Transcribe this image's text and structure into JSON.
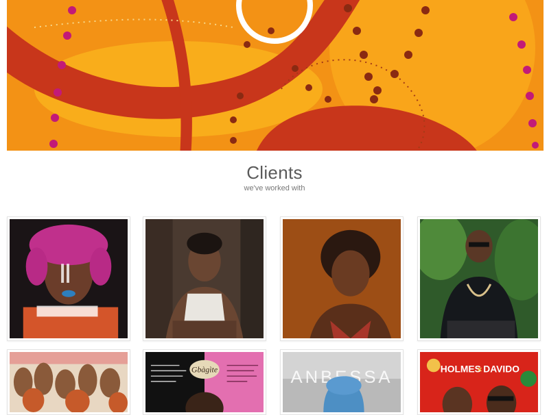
{
  "section": {
    "title": "Clients",
    "subtitle": "we've worked with"
  },
  "colors": {
    "hero_orange": "#f39215",
    "hero_red": "#c8361b",
    "hero_yellow": "#f9b21c",
    "hero_dot_dark": "#8a2a12",
    "hero_dot_pink": "#c21a78",
    "title_gray": "#5a5a5a"
  },
  "clients": {
    "row1": [
      {
        "name": "client-photo-pink-hair-woman"
      },
      {
        "name": "client-photo-tattooed-man"
      },
      {
        "name": "client-photo-locs-woman"
      },
      {
        "name": "client-photo-sunglasses-man"
      }
    ],
    "row2": [
      {
        "name": "client-artwork-crowd"
      },
      {
        "name": "client-artwork-album-cover",
        "text_top": "Gbàgìte"
      },
      {
        "name": "client-artwork-anbessa",
        "text": "ANBESSA"
      },
      {
        "name": "client-artwork-holmes-davido",
        "text_left": "HOLMES",
        "text_right": "DAVIDO"
      }
    ]
  }
}
